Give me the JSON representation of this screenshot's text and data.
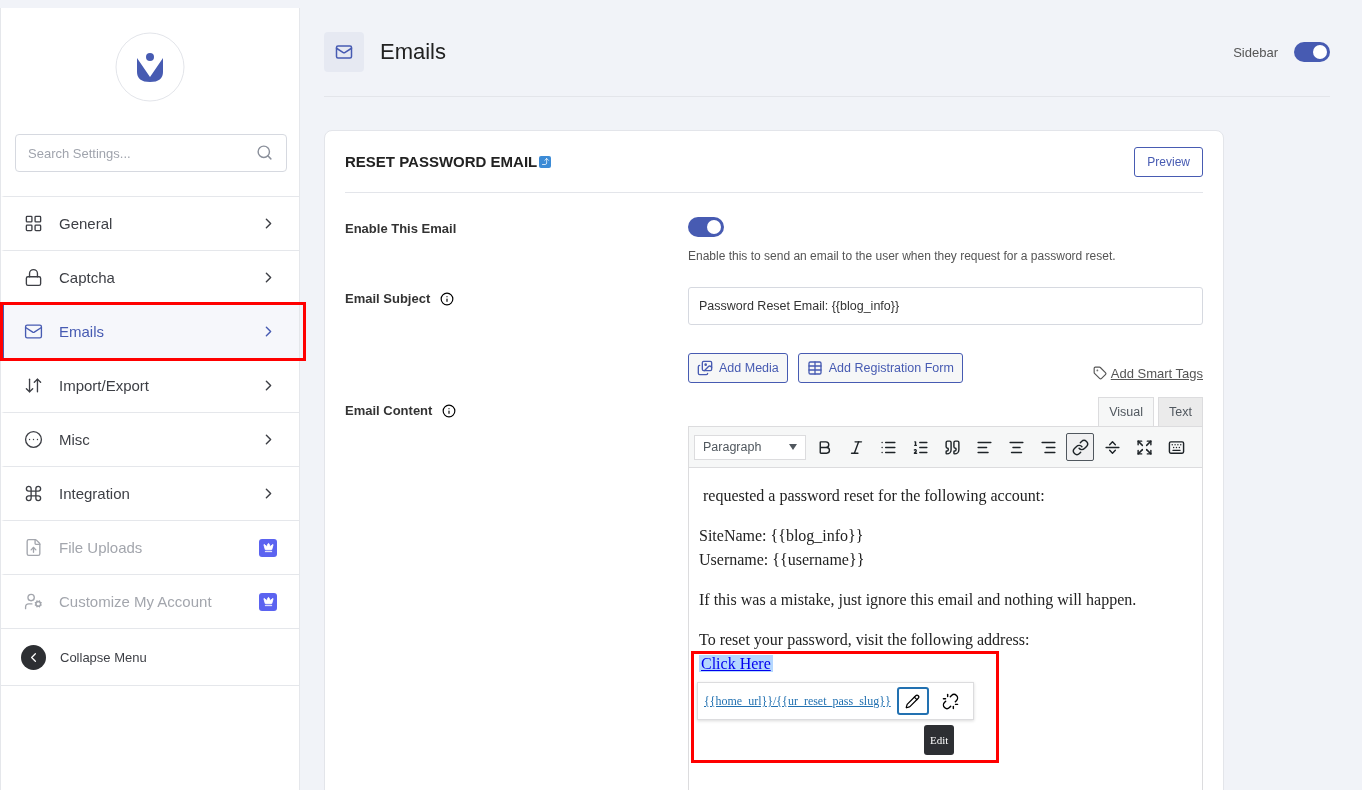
{
  "sidebar": {
    "search": {
      "placeholder": "Search Settings..."
    },
    "items": [
      {
        "kind": "grid",
        "label": "General",
        "selected": false,
        "locked": false
      },
      {
        "kind": "lock",
        "label": "Captcha",
        "selected": false,
        "locked": false
      },
      {
        "kind": "mail",
        "label": "Emails",
        "selected": true,
        "locked": false
      },
      {
        "kind": "sort",
        "label": "Import/Export",
        "selected": false,
        "locked": false
      },
      {
        "kind": "dots",
        "label": "Misc",
        "selected": false,
        "locked": false
      },
      {
        "kind": "command",
        "label": "Integration",
        "selected": false,
        "locked": false
      },
      {
        "kind": "file",
        "label": "File Uploads",
        "selected": false,
        "locked": true
      },
      {
        "kind": "user",
        "label": "Customize My Account",
        "selected": false,
        "locked": true
      }
    ],
    "collapse": "Collapse Menu"
  },
  "header": {
    "title": "Emails",
    "sidebar_toggle": {
      "label": "Sidebar",
      "on": true
    }
  },
  "card": {
    "title": "RESET PASSWORD EMAIL",
    "preview": "Preview",
    "enable": {
      "label": "Enable This Email",
      "on": true,
      "help": "Enable this to send an email to the user when they request for a password reset."
    },
    "subject": {
      "label": "Email Subject",
      "value": "Password Reset Email: {{blog_info}}"
    },
    "media_buttons": [
      {
        "kind": "media",
        "label": "Add Media"
      },
      {
        "kind": "form",
        "label": "Add Registration Form"
      }
    ],
    "smart_tags": "Add Smart Tags",
    "content_label": "Email Content",
    "editor_tabs": [
      {
        "label": "Visual",
        "selected": true
      },
      {
        "label": "Text",
        "selected": false
      }
    ],
    "format": "Paragraph",
    "toolbar": [
      {
        "kind": "bold",
        "active": false
      },
      {
        "kind": "italic",
        "active": false
      },
      {
        "kind": "bullets",
        "active": false
      },
      {
        "kind": "numbers",
        "active": false
      },
      {
        "kind": "quote",
        "active": false
      },
      {
        "kind": "left",
        "active": false
      },
      {
        "kind": "center",
        "active": false
      },
      {
        "kind": "right",
        "active": false
      },
      {
        "kind": "link",
        "active": true
      },
      {
        "kind": "more",
        "active": false
      },
      {
        "kind": "fullscreen",
        "active": false
      },
      {
        "kind": "keyboard",
        "active": false
      }
    ],
    "body": [
      {
        "kind": "text",
        "lines": [
          " requested a password reset for the following account:"
        ]
      },
      {
        "kind": "text",
        "lines": [
          "SiteName: {{blog_info}}",
          "Username: {{username}}"
        ]
      },
      {
        "kind": "text",
        "lines": [
          "If this was a mistake, just ignore this email and nothing will happen."
        ]
      },
      {
        "kind": "text",
        "lines": [
          "To reset your password, visit the following address:"
        ]
      }
    ],
    "link_text": "Click Here",
    "link_popup": {
      "url": "{{home_url}}/{{ur_reset_pass_slug}}",
      "tooltip": "Edit"
    }
  }
}
